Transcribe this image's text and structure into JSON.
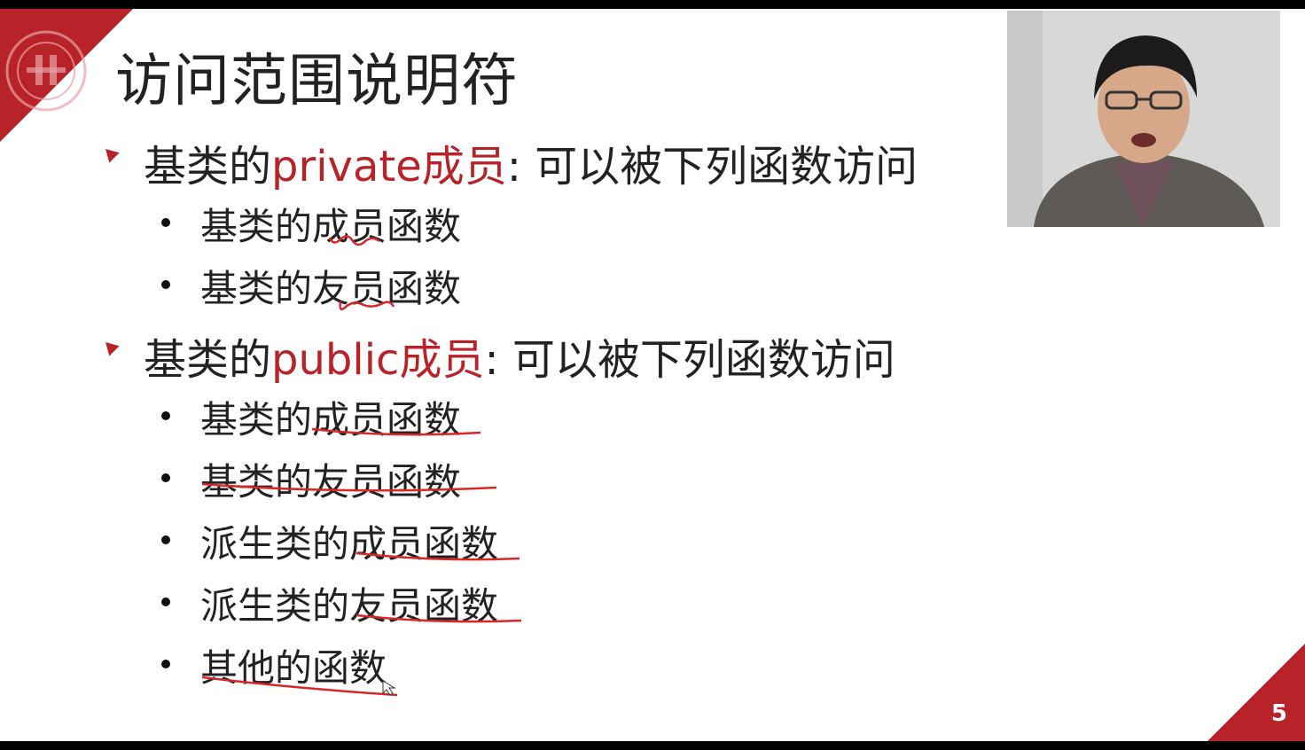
{
  "slide": {
    "title": "访问范围说明符",
    "page_number": "5",
    "bullets": [
      {
        "level": 1,
        "prefix": "基类的",
        "highlight": "private成员",
        "suffix": ": 可以被下列函数访问"
      },
      {
        "level": 2,
        "text": "基类的成员函数"
      },
      {
        "level": 2,
        "text": "基类的友员函数"
      },
      {
        "level": 1,
        "prefix": "基类的",
        "highlight": "public成员",
        "suffix": ": 可以被下列函数访问"
      },
      {
        "level": 2,
        "text": "基类的成员函数"
      },
      {
        "level": 2,
        "text": "基类的友员函数"
      },
      {
        "level": 2,
        "text": "派生类的成员函数"
      },
      {
        "level": 2,
        "text": "派生类的友员函数"
      },
      {
        "level": 2,
        "text": "其他的函数"
      }
    ]
  },
  "colors": {
    "accent_red": "#b8232a",
    "text": "#222222",
    "background": "#ffffff",
    "frame": "#000000"
  },
  "icons": {
    "logo": "university-seal-icon",
    "level1_bullet": "triangle-bullet-icon",
    "level2_bullet": "dot-bullet-icon"
  }
}
